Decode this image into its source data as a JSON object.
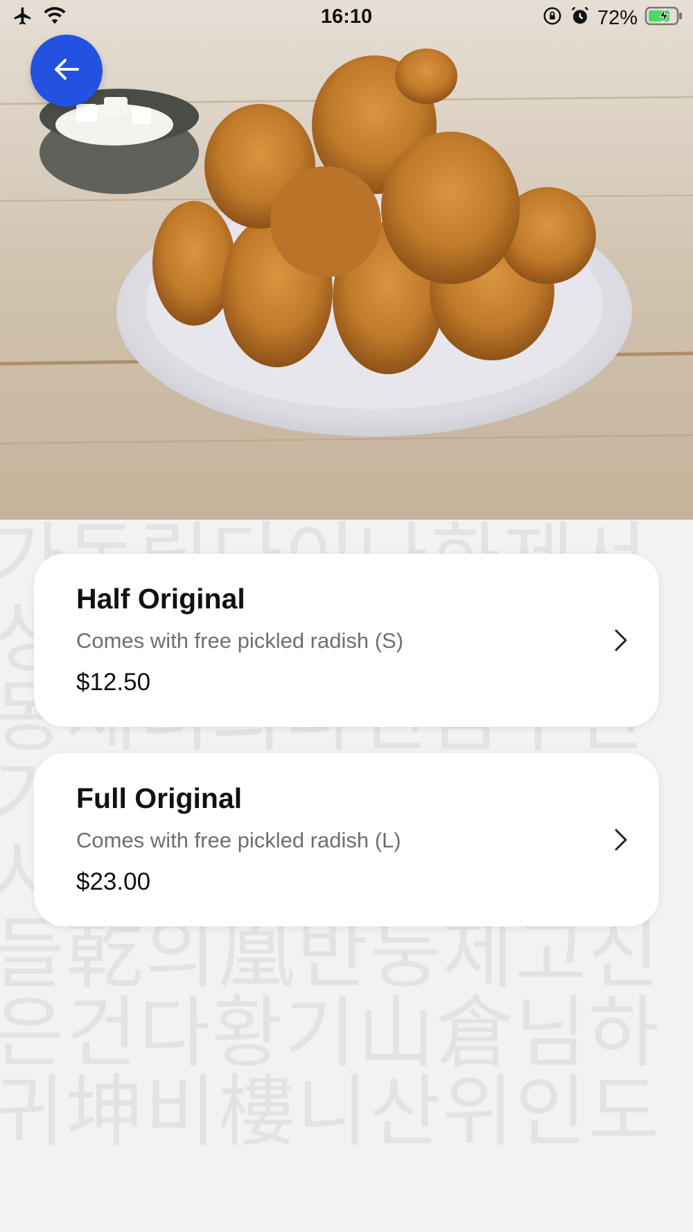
{
  "status_bar": {
    "time": "16:10",
    "battery_percent": "72%",
    "icons": [
      "airplane-icon",
      "wifi-icon",
      "rotation-lock-icon",
      "alarm-icon",
      "battery-charging-icon"
    ]
  },
  "hero": {
    "image": "fried-chicken-photo",
    "back_icon": "arrow-left-icon"
  },
  "options": [
    {
      "title": "Half Original",
      "description": "Comes with free pickled radish (S)",
      "price": "$12.50",
      "chevron": "chevron-right-icon"
    },
    {
      "title": "Full Original",
      "description": "Comes with free pickled radish (L)",
      "price": "$23.00",
      "chevron": "chevron-right-icon"
    }
  ],
  "colors": {
    "accent": "#2352e0",
    "card_bg": "#ffffff",
    "page_bg": "#f2f2f3",
    "secondary_text": "#6e6e73"
  }
}
